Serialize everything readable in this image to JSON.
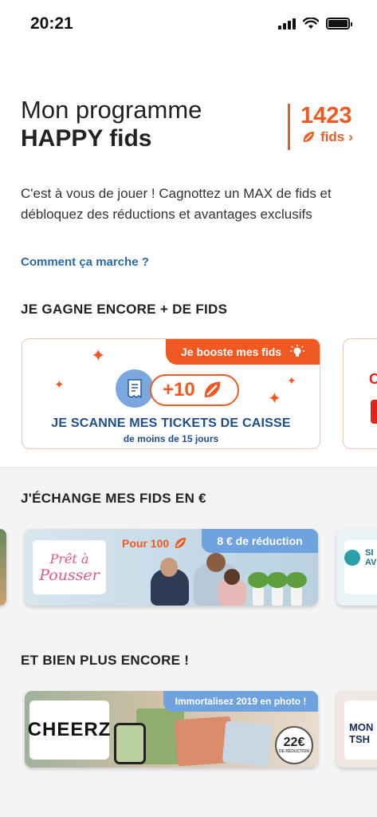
{
  "status_bar": {
    "time": "20:21"
  },
  "header": {
    "title_light": "Mon programme",
    "title_bold": "HAPPY fids",
    "points_value": "1423",
    "points_unit": "fids",
    "points_chevron": "›",
    "description": "C'est à vous de jouer ! Cagnottez un MAX de fids et débloquez des réductions et avantages exclusifs",
    "how_link": "Comment ça marche ?"
  },
  "section_earn": {
    "title": "JE GAGNE ENCORE + DE FIDS",
    "card": {
      "tag": "Je booste mes fids",
      "bonus": "+10",
      "title": "JE SCANNE MES TICKETS DE CAISSE",
      "subtitle": "de moins de 15 jours"
    },
    "peek_letter": "C"
  },
  "section_exchange": {
    "title": "J'ÉCHANGE MES FIDS EN €",
    "card": {
      "brand_line1": "Prêt à",
      "brand_line2": "Pousser",
      "cost_label": "Pour 100",
      "reward": "8 € de réduction"
    },
    "peek_text": "SI\nAV"
  },
  "section_more": {
    "title": "ET BIEN PLUS ENCORE !",
    "card": {
      "brand": "CHEERZ",
      "tag": "Immortalisez 2019 en photo !",
      "discount_value": "22€",
      "discount_label": "DE RÉDUCTION"
    },
    "peek_text": "MON\nTSH"
  },
  "colors": {
    "accent_orange": "#f05a22",
    "link_blue": "#2a6aa6",
    "navy": "#1f4e8c",
    "tag_blue": "#6ea3e0"
  },
  "icons": [
    "signal-icon",
    "wifi-icon",
    "battery-icon",
    "leaf-icon",
    "bulb-icon",
    "sparkle-icon",
    "ticket-icon"
  ]
}
